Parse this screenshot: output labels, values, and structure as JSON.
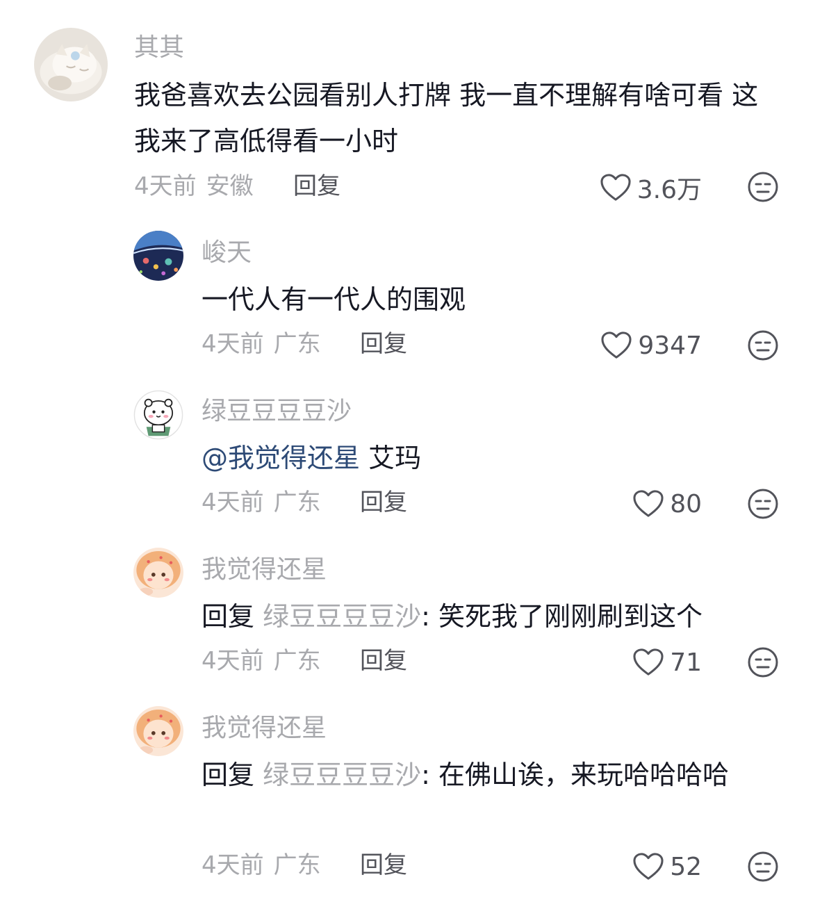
{
  "comments": [
    {
      "username": "其其",
      "text": "我爸喜欢去公园看别人打牌 我一直不理解有啥可看 这我来了高低得看一小时",
      "time": "4天前",
      "location": "安徽",
      "reply_label": "回复",
      "likes": "3.6万",
      "avatar_icon": "cat-avatar-icon"
    },
    {
      "username": "峻天",
      "text": "一代人有一代人的围观",
      "time": "4天前",
      "location": "广东",
      "reply_label": "回复",
      "likes": "9347",
      "avatar_icon": "space-avatar-icon"
    },
    {
      "username": "绿豆豆豆豆沙",
      "mention": "@我觉得还星",
      "text": "艾玛",
      "time": "4天前",
      "location": "广东",
      "reply_label": "回复",
      "likes": "80",
      "avatar_icon": "cartoon-avatar-icon"
    },
    {
      "username": "我觉得还星",
      "reply_prefix": "回复",
      "reply_to": "绿豆豆豆豆沙",
      "text": ": 笑死我了刚刚刷到这个",
      "time": "4天前",
      "location": "广东",
      "reply_label": "回复",
      "likes": "71",
      "avatar_icon": "doll-avatar-icon"
    },
    {
      "username": "我觉得还星",
      "reply_prefix": "回复",
      "reply_to": "绿豆豆豆豆沙",
      "text": ": 在佛山诶，来玩哈哈哈哈",
      "time": "4天前",
      "location": "广东",
      "reply_label": "回复",
      "likes": "52",
      "avatar_icon": "doll-avatar-icon"
    }
  ],
  "colors": {
    "text": "#161823",
    "muted": "#a8a9ad",
    "action": "#52535a",
    "mention": "#2d4a76"
  }
}
